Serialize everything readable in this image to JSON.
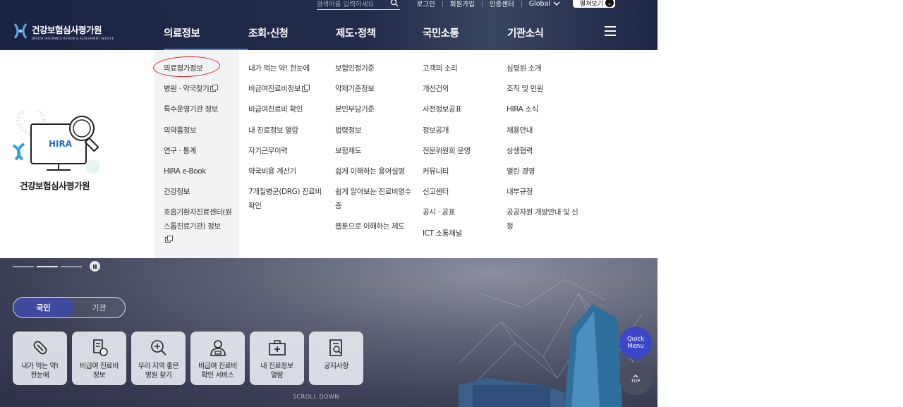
{
  "header": {
    "search_placeholder": "검색어를 입력하세요",
    "util_links": [
      "로그인",
      "회원가입",
      "인증센터"
    ],
    "global_label": "Global",
    "open_label": "펼쳐보기",
    "logo_ko": "건강보험심사평가원",
    "logo_en": "HEALTH INSURANCE REVIEW & ASSESSMENT SERVICE",
    "gnb": [
      "의료정보",
      "조회·신청",
      "제도·정책",
      "국민소통",
      "기관소식"
    ]
  },
  "mega": {
    "brand_badge": "HIRA",
    "brand_name": "건강보험심사평가원",
    "col1": [
      "의료평가정보",
      "병원 · 약국찾기",
      "특수운영기관 정보",
      "의약품정보",
      "연구 · 통계",
      "HIRA e-Book",
      "건강정보",
      "호흡기환자진료센터(원스톱진료기관) 정보"
    ],
    "col2": [
      "내가 먹는 약! 한눈에",
      "비급여진료비정보",
      "비급여진료비 확인",
      "내 진료정보 열람",
      "자기근무이력",
      "약국비용 계산기",
      "7개질병군(DRG) 진료비 확인"
    ],
    "col3": [
      "보험인정기준",
      "약제기준정보",
      "본인부담기준",
      "법령정보",
      "보험제도",
      "쉽게 이해하는 용어설명",
      "쉽게 알아보는 진료비영수증",
      "웹툰으로 이해하는 제도"
    ],
    "col4": [
      "고객의 소리",
      "개선건의",
      "사전정보공표",
      "정보공개",
      "전문위원회 운영",
      "커뮤니티",
      "신고센터",
      "공시 · 공표",
      "ICT 소통채널"
    ],
    "col5": [
      "심평원 소개",
      "조직 및 인원",
      "HIRA 소식",
      "채용안내",
      "상생협력",
      "열린 경영",
      "내부규정",
      "공공자원 개방안내 및 신청"
    ]
  },
  "hero": {
    "toggle": [
      "국민",
      "기관"
    ],
    "quick_items": [
      {
        "label": "내가 먹는 약!\n한눈에",
        "icon": "pill-icon"
      },
      {
        "label": "비급여 진료비\n정보",
        "icon": "receipt-coin-icon"
      },
      {
        "label": "우리 지역 좋은\n병원 찾기",
        "icon": "magnifier-plus-icon"
      },
      {
        "label": "비급여 진료비\n확인 서비스",
        "icon": "doctor-icon"
      },
      {
        "label": "내 진료정보\n열람",
        "icon": "medical-bag-icon"
      },
      {
        "label": "공지사항",
        "icon": "notice-search-icon"
      }
    ],
    "scroll_text": "SCROLL DOWN"
  },
  "floating": {
    "quick_menu": "Quick\nMenu",
    "top": "TOP"
  },
  "colors": {
    "header_bg": "#1a2343",
    "accent_blue": "#3b82f6",
    "toggle_on": "#3f4a9e",
    "quick_menu": "#3b46c9",
    "annotation": "#e32020"
  }
}
